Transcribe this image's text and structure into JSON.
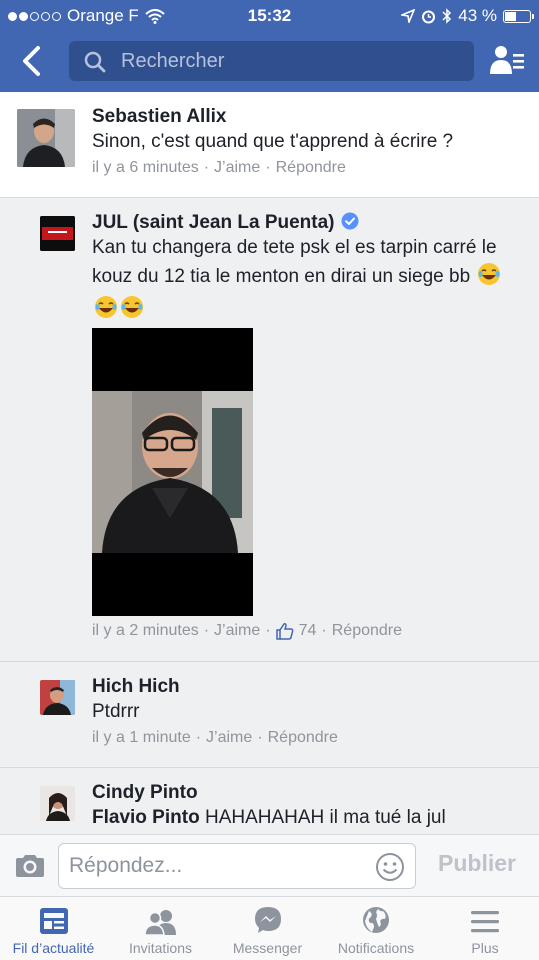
{
  "status_bar": {
    "carrier": "Orange F",
    "time": "15:32",
    "battery": "43 %",
    "battery_level": 0.43
  },
  "nav": {
    "search_placeholder": "Rechercher"
  },
  "comments": [
    {
      "author": "Sebastien Allix",
      "text": "Sinon, c'est quand que t'apprend à écrire ?",
      "time": "il y a 6 minutes",
      "like_label": "J’aime",
      "reply_label": "Répondre"
    },
    {
      "author": "JUL (saint Jean La Puenta)",
      "verified": true,
      "text": "Kan tu changera de tete psk el es tarpin carré le kouz du 12 tia le menton en dirai un siege bb",
      "emoji": [
        "😂",
        "😂",
        "😂"
      ],
      "time": "il y a 2 minutes",
      "like_label": "J’aime",
      "likes": "74",
      "reply_label": "Répondre"
    },
    {
      "author": "Hich Hich",
      "text": "Ptdrrr",
      "time": "il y a 1 minute",
      "like_label": "J’aime",
      "reply_label": "Répondre"
    },
    {
      "author": "Cindy Pinto",
      "mention": "Flavio Pinto",
      "text": "HAHAHAHAH il ma tué la jul"
    }
  ],
  "reply_bar": {
    "placeholder": "Répondez...",
    "publish_label": "Publier"
  },
  "tabs": [
    {
      "label": "Fil d’actualité",
      "icon": "news-feed-icon",
      "active": true
    },
    {
      "label": "Invitations",
      "icon": "friends-icon",
      "active": false
    },
    {
      "label": "Messenger",
      "icon": "messenger-icon",
      "active": false
    },
    {
      "label": "Notifications",
      "icon": "globe-icon",
      "active": false
    },
    {
      "label": "Plus",
      "icon": "menu-icon",
      "active": false
    }
  ],
  "colors": {
    "brand_blue": "#4267b2",
    "meta_gray": "#90949c",
    "verified_blue": "#5890ff"
  }
}
